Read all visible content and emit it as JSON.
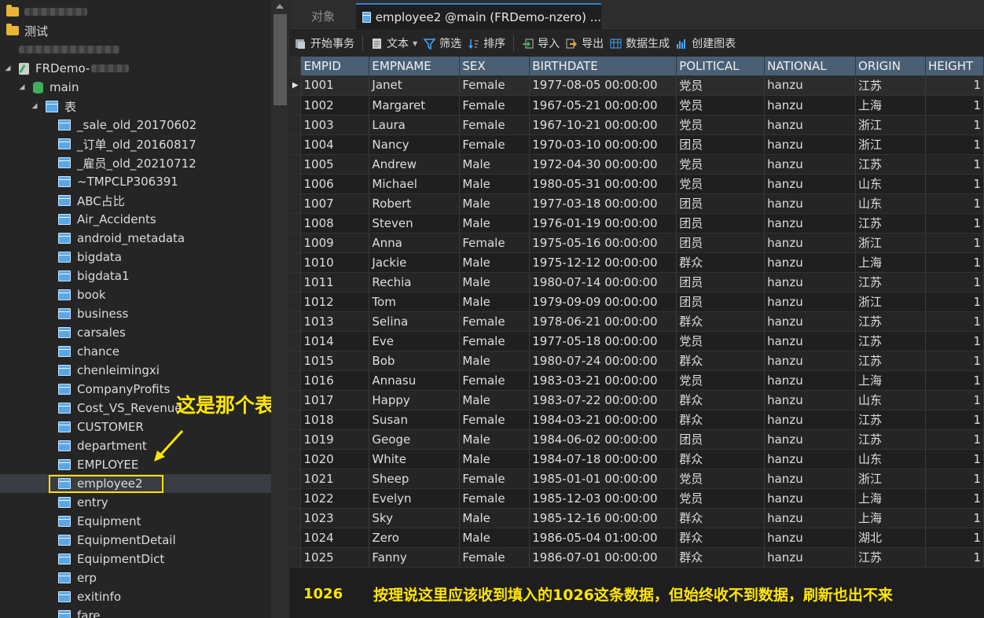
{
  "tabs": {
    "objects": "对象",
    "active": "employee2 @main (FRDemo-nzero) ..."
  },
  "toolbar": {
    "begin_transaction": "开始事务",
    "text": "文本",
    "filter": "筛选",
    "sort": "排序",
    "import": "导入",
    "export": "导出",
    "data_generation": "数据生成",
    "create_chart": "创建图表"
  },
  "sidebar": {
    "folder_test": "测试",
    "connection": "FRDemo-",
    "database": "main",
    "tables_node": "表",
    "tables": [
      "_sale_old_20170602",
      "_订单_old_20160817",
      "_雇员_old_20210712",
      "~TMPCLP306391",
      "ABC占比",
      "Air_Accidents",
      "android_metadata",
      "bigdata",
      "bigdata1",
      "book",
      "business",
      "carsales",
      "chance",
      "chenleimingxi",
      "CompanyProfits",
      "Cost_VS_Revenue",
      "CUSTOMER",
      "department",
      "EMPLOYEE",
      "employee2",
      "entry",
      "Equipment",
      "EquipmentDetail",
      "EquipmentDict",
      "erp",
      "exitinfo",
      "fare"
    ],
    "selected_table": "employee2"
  },
  "annotation": {
    "label": "这是那个表",
    "note": "按理说这里应该收到填入的1026这条数据，但始终收不到数据，刷新也出不来",
    "new_row_empid": "1026"
  },
  "grid": {
    "columns": [
      "EMPID",
      "EMPNAME",
      "SEX",
      "BIRTHDATE",
      "POLITICAL",
      "NATIONAL",
      "ORIGIN",
      "HEIGHT"
    ],
    "rows": [
      [
        "1001",
        "Janet",
        "Female",
        "1977-08-05 00:00:00",
        "党员",
        "hanzu",
        "江苏",
        "1"
      ],
      [
        "1002",
        "Margaret",
        "Female",
        "1967-05-21 00:00:00",
        "党员",
        "hanzu",
        "上海",
        "1"
      ],
      [
        "1003",
        "Laura",
        "Female",
        "1967-10-21 00:00:00",
        "党员",
        "hanzu",
        "浙江",
        "1"
      ],
      [
        "1004",
        "Nancy",
        "Female",
        "1970-03-10 00:00:00",
        "团员",
        "hanzu",
        "浙江",
        "1"
      ],
      [
        "1005",
        "Andrew",
        "Male",
        "1972-04-30 00:00:00",
        "党员",
        "hanzu",
        "江苏",
        "1"
      ],
      [
        "1006",
        "Michael",
        "Male",
        "1980-05-31 00:00:00",
        "党员",
        "hanzu",
        "山东",
        "1"
      ],
      [
        "1007",
        "Robert",
        "Male",
        "1977-03-18 00:00:00",
        "团员",
        "hanzu",
        "山东",
        "1"
      ],
      [
        "1008",
        "Steven",
        "Male",
        "1976-01-19 00:00:00",
        "团员",
        "hanzu",
        "江苏",
        "1"
      ],
      [
        "1009",
        "Anna",
        "Female",
        "1975-05-16 00:00:00",
        "团员",
        "hanzu",
        "浙江",
        "1"
      ],
      [
        "1010",
        "Jackie",
        "Male",
        "1975-12-12 00:00:00",
        "群众",
        "hanzu",
        "上海",
        "1"
      ],
      [
        "1011",
        "Rechia",
        "Male",
        "1980-07-14 00:00:00",
        "团员",
        "hanzu",
        "江苏",
        "1"
      ],
      [
        "1012",
        "Tom",
        "Male",
        "1979-09-09 00:00:00",
        "团员",
        "hanzu",
        "浙江",
        "1"
      ],
      [
        "1013",
        "Selina",
        "Female",
        "1978-06-21 00:00:00",
        "群众",
        "hanzu",
        "江苏",
        "1"
      ],
      [
        "1014",
        "Eve",
        "Female",
        "1977-05-18 00:00:00",
        "党员",
        "hanzu",
        "江苏",
        "1"
      ],
      [
        "1015",
        "Bob",
        "Male",
        "1980-07-24 00:00:00",
        "群众",
        "hanzu",
        "江苏",
        "1"
      ],
      [
        "1016",
        "Annasu",
        "Female",
        "1983-03-21 00:00:00",
        "党员",
        "hanzu",
        "上海",
        "1"
      ],
      [
        "1017",
        "Happy",
        "Male",
        "1983-07-22 00:00:00",
        "群众",
        "hanzu",
        "山东",
        "1"
      ],
      [
        "1018",
        "Susan",
        "Female",
        "1984-03-21 00:00:00",
        "群众",
        "hanzu",
        "江苏",
        "1"
      ],
      [
        "1019",
        "Geoge",
        "Male",
        "1984-06-02 00:00:00",
        "团员",
        "hanzu",
        "江苏",
        "1"
      ],
      [
        "1020",
        "White",
        "Male",
        "1984-07-18 00:00:00",
        "群众",
        "hanzu",
        "山东",
        "1"
      ],
      [
        "1021",
        "Sheep",
        "Female",
        "1985-01-01 00:00:00",
        "党员",
        "hanzu",
        "浙江",
        "1"
      ],
      [
        "1022",
        "Evelyn",
        "Female",
        "1985-12-03 00:00:00",
        "党员",
        "hanzu",
        "上海",
        "1"
      ],
      [
        "1023",
        "Sky",
        "Male",
        "1985-12-16 00:00:00",
        "群众",
        "hanzu",
        "上海",
        "1"
      ],
      [
        "1024",
        "Zero",
        "Male",
        "1986-05-04 01:00:00",
        "群众",
        "hanzu",
        "湖北",
        "1"
      ],
      [
        "1025",
        "Fanny",
        "Female",
        "1986-07-01 00:00:00",
        "群众",
        "hanzu",
        "江苏",
        "1"
      ]
    ]
  },
  "colors": {
    "annotation": "#ffe600",
    "header_bg": "#4a5f74",
    "accent": "#2f7fd0"
  }
}
